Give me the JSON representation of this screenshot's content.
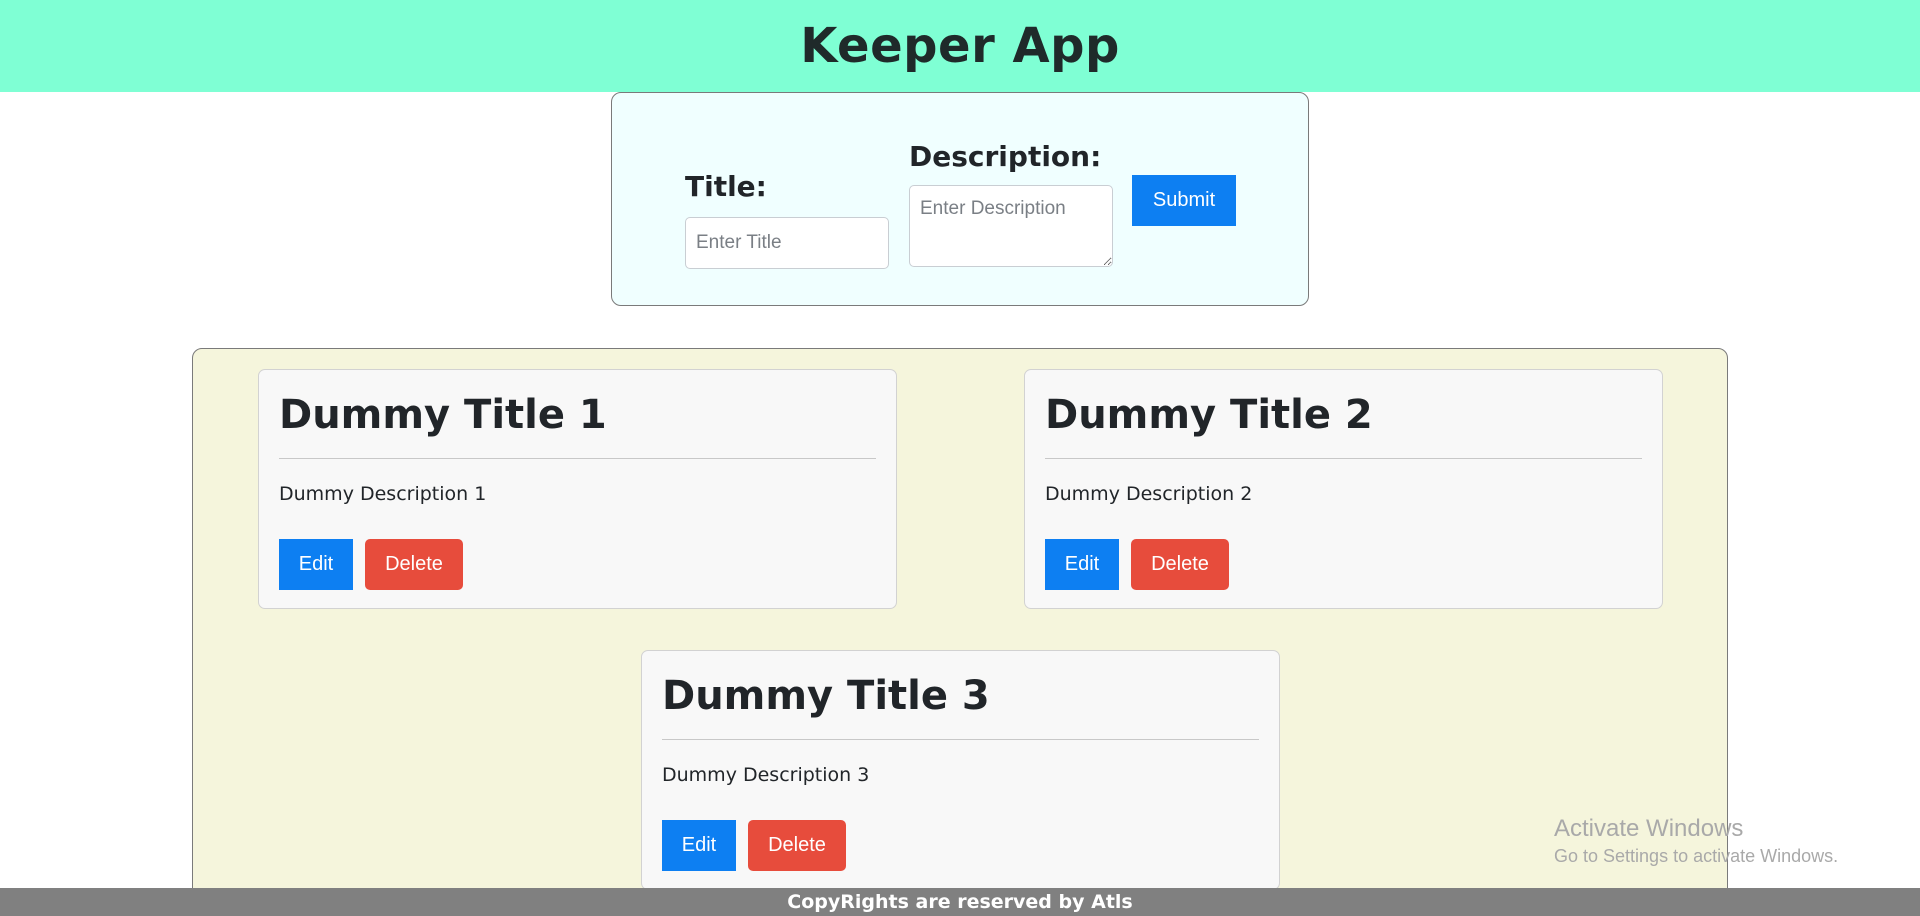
{
  "header": {
    "title": "Keeper App"
  },
  "form": {
    "title_label": "Title:",
    "title_placeholder": "Enter Title",
    "title_value": "",
    "description_label": "Description:",
    "description_placeholder": "Enter Description",
    "description_value": "",
    "submit_label": "Submit"
  },
  "notes": [
    {
      "title": "Dummy Title 1",
      "description": "Dummy Description 1",
      "edit_label": "Edit",
      "delete_label": "Delete"
    },
    {
      "title": "Dummy Title 2",
      "description": "Dummy Description 2",
      "edit_label": "Edit",
      "delete_label": "Delete"
    },
    {
      "title": "Dummy Title 3",
      "description": "Dummy Description 3",
      "edit_label": "Edit",
      "delete_label": "Delete"
    }
  ],
  "footer": {
    "text": "CopyRights are reserved by Atls"
  },
  "watermark": {
    "title": "Activate Windows",
    "subtitle": "Go to Settings to activate Windows."
  },
  "colors": {
    "header_bg": "#7fffd4",
    "form_bg": "#f0ffff",
    "notes_bg": "#f5f5dc",
    "primary_button": "#0d7ff2",
    "danger_button": "#e74c3c",
    "footer_bg": "#808080"
  }
}
